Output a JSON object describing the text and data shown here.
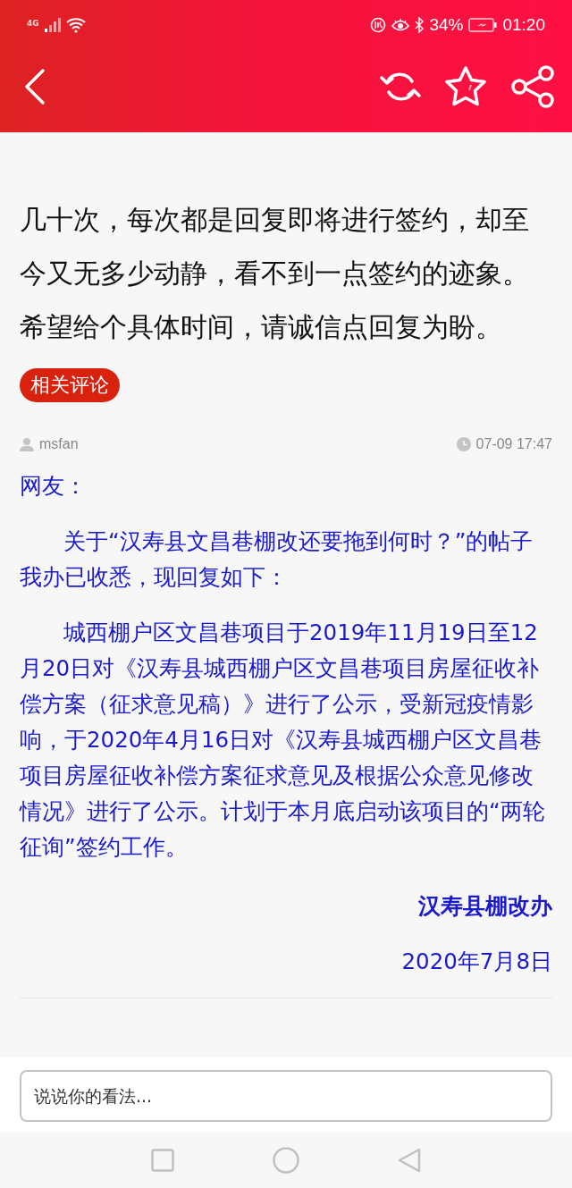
{
  "status_bar": {
    "network": "4G",
    "battery": "34%",
    "time": "01:20"
  },
  "article": {
    "text": "几十次，每次都是回复即将进行签约，却至今又无多少动静，看不到一点签约的迹象。希望给个具体时间，请诚信点回复为盼。"
  },
  "section_tag": "相关评论",
  "comment": {
    "user": "msfan",
    "time": "07-09 17:47",
    "greeting": "网友：",
    "paragraphs": [
      "关于“汉寿县文昌巷棚改还要拖到何时？”的帖子我办已收悉，现回复如下：",
      "城西棚户区文昌巷项目于2019年11月19日至12月20日对《汉寿县城西棚户区文昌巷项目房屋征收补偿方案（征求意见稿）》进行了公示，受新冠疫情影响，于2020年4月16日对《汉寿县城西棚户区文昌巷项目房屋征收补偿方案征求意见及根据公众意见修改情况》进行了公示。计划于本月底启动该项目的“两轮征询”签约工作。"
    ],
    "signature": "汉寿县棚改办",
    "date": "2020年7月8日"
  },
  "comment_input": {
    "placeholder": "说说你的看法..."
  }
}
